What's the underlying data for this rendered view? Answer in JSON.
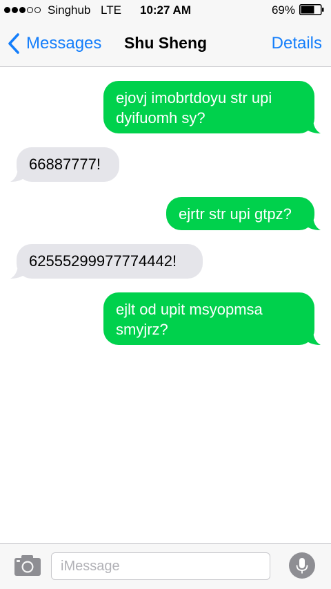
{
  "status_bar": {
    "carrier": "Singhub",
    "network": "LTE",
    "time": "10:27 AM",
    "battery_percent": "69%",
    "battery_level": 0.69,
    "signal_bars_filled": 3,
    "signal_bars_total": 5
  },
  "nav": {
    "back_label": "Messages",
    "title": "Shu Sheng",
    "details_label": "Details"
  },
  "messages": [
    {
      "direction": "sent",
      "text": "ejovj imobrtdoyu str upi\ndyifuomh sy?"
    },
    {
      "direction": "received",
      "text": "66887777!"
    },
    {
      "direction": "sent",
      "text": "ejrtr str upi gtpz?"
    },
    {
      "direction": "received",
      "text": "62555299977774442!"
    },
    {
      "direction": "sent",
      "text": "ejlt od upit msyopmsa\nsmyjrz?"
    }
  ],
  "input_bar": {
    "placeholder": "iMessage",
    "value": ""
  },
  "colors": {
    "accent": "#147efb",
    "sent_bubble": "#00d14c",
    "received_bubble": "#e5e5ea",
    "bar_background": "#f7f7f7"
  },
  "icons": {
    "back": "chevron-left-icon",
    "camera": "camera-icon",
    "mic": "microphone-icon",
    "battery": "battery-icon"
  }
}
